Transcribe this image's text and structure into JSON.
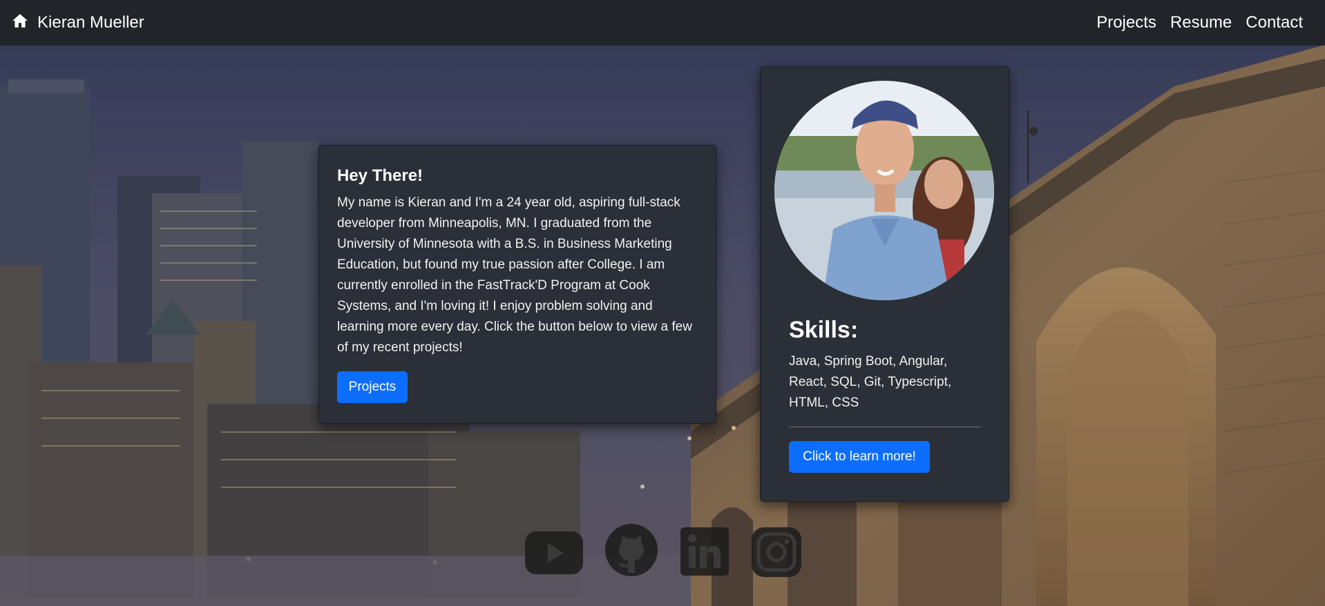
{
  "nav": {
    "brand": "Kieran Mueller",
    "links": [
      "Projects",
      "Resume",
      "Contact"
    ]
  },
  "about": {
    "title": "Hey There!",
    "text": "My name is Kieran and I'm a 24 year old, aspiring full-stack developer from Minneapolis, MN. I graduated from the University of Minnesota with a B.S. in Business Marketing Education, but found my true passion after College. I am currently enrolled in the FastTrack'D Program at Cook Systems, and I'm loving it! I enjoy problem solving and learning more every day. Click the button below to view a few of my recent projects!",
    "button": "Projects"
  },
  "skills": {
    "title": "Skills:",
    "text": "Java, Spring Boot, Angular, React, SQL, Git, Typescript, HTML, CSS",
    "button": "Click to learn more!"
  },
  "socials": [
    "youtube-icon",
    "github-icon",
    "linkedin-icon",
    "instagram-icon"
  ],
  "colors": {
    "navbar": "#212529",
    "card": "#2b2f37",
    "accent": "#0d6efd"
  }
}
